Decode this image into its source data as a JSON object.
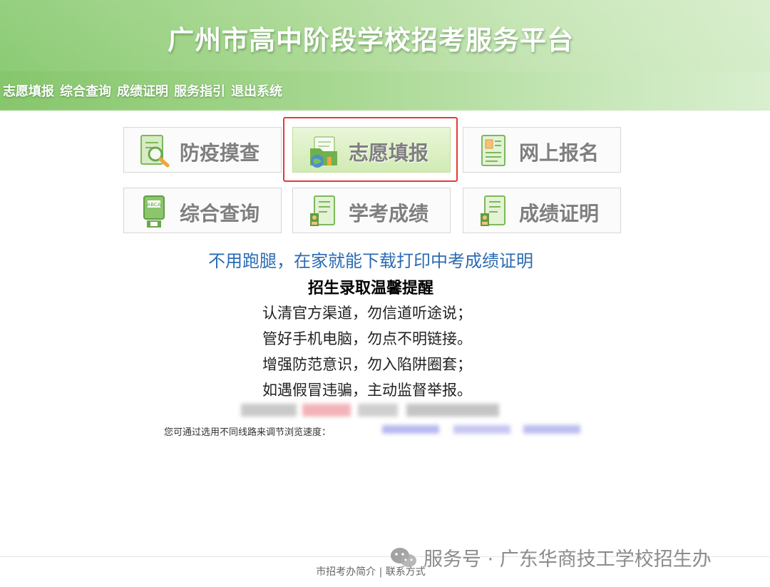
{
  "header": {
    "title": "广州市高中阶段学校招考服务平台"
  },
  "nav": {
    "items": [
      "志愿填报",
      "综合查询",
      "成绩证明",
      "服务指引",
      "退出系统"
    ]
  },
  "tiles": [
    {
      "label": "防疫摸查",
      "icon": "magnifier-document-icon",
      "active": false
    },
    {
      "label": "志愿填报",
      "icon": "globe-folder-icon",
      "active": true
    },
    {
      "label": "网上报名",
      "icon": "id-card-icon",
      "active": false
    },
    {
      "label": "综合查询",
      "icon": "query-terminal-icon",
      "active": false
    },
    {
      "label": "学考成绩",
      "icon": "score-document-icon",
      "active": false
    },
    {
      "label": "成绩证明",
      "icon": "certificate-document-icon",
      "active": false
    }
  ],
  "promo": "不用跑腿，在家就能下载打印中考成绩证明",
  "tips": {
    "title": "招生录取温馨提醒",
    "lines": [
      "认清官方渠道，勿信道听途说；",
      "管好手机电脑，勿点不明链接。",
      "增强防范意识，勿入陷阱圈套；",
      "如遇假冒违骗，主动监督举报。"
    ]
  },
  "speed": {
    "label": "您可通过选用不同线路来调节浏览速度："
  },
  "footer": {
    "link1": "市招考办简介",
    "separator": "|",
    "link2": "联系方式"
  },
  "watermark": {
    "text": "服务号 · 广东华商技工学校招生办"
  },
  "colors": {
    "banner": "#a6d78f",
    "promo": "#2a6bb3",
    "highlight": "#e23b3b",
    "tile_text": "#7f7f7f"
  }
}
